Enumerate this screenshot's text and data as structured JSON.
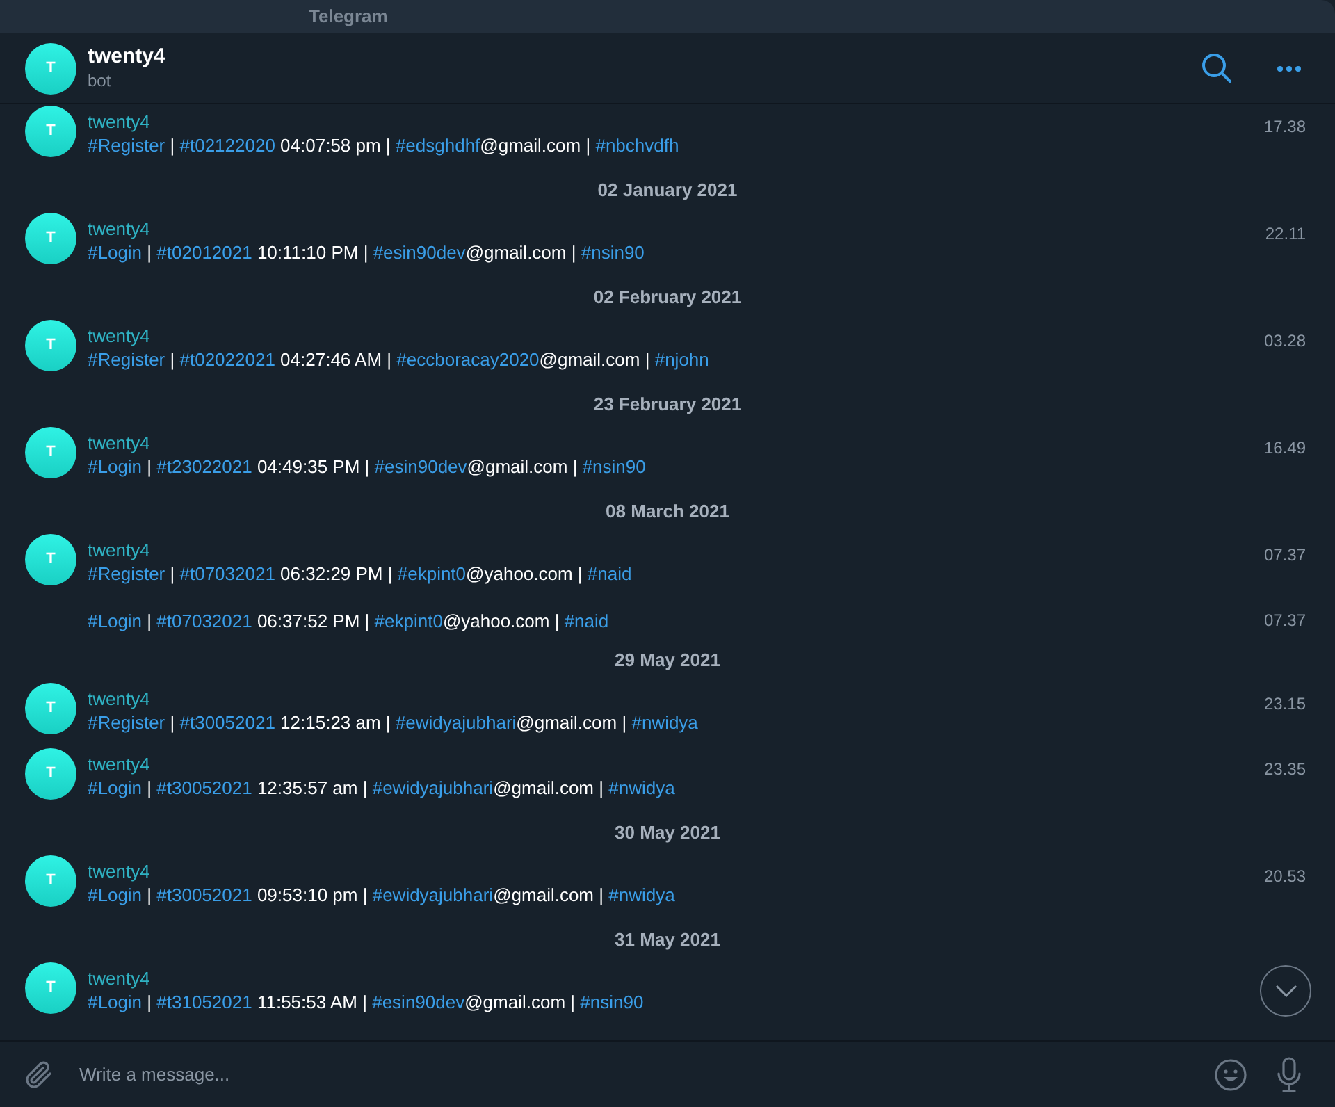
{
  "window": {
    "title": "Telegram"
  },
  "chat": {
    "avatar": "T",
    "name": "twenty4",
    "subtitle": "bot"
  },
  "items": [
    {
      "kind": "message",
      "avatar": "T",
      "sender": "twenty4",
      "time": "17.38",
      "parts": [
        {
          "kind": "tag",
          "text": "#Register"
        },
        {
          "kind": "plain",
          "text": " | "
        },
        {
          "kind": "tag",
          "text": "#t02122020"
        },
        {
          "kind": "plain",
          "text": " 04:07:58 pm | "
        },
        {
          "kind": "tag",
          "text": "#edsghdhf"
        },
        {
          "kind": "plain",
          "text": "@gmail.com | "
        },
        {
          "kind": "tag",
          "text": "#nbchvdfh"
        }
      ]
    },
    {
      "kind": "date",
      "text": "02 January 2021"
    },
    {
      "kind": "message",
      "avatar": "T",
      "sender": "twenty4",
      "time": "22.11",
      "parts": [
        {
          "kind": "tag",
          "text": "#Login"
        },
        {
          "kind": "plain",
          "text": " | "
        },
        {
          "kind": "tag",
          "text": "#t02012021"
        },
        {
          "kind": "plain",
          "text": " 10:11:10 PM | "
        },
        {
          "kind": "tag",
          "text": "#esin90dev"
        },
        {
          "kind": "plain",
          "text": "@gmail.com | "
        },
        {
          "kind": "tag",
          "text": "#nsin90"
        }
      ]
    },
    {
      "kind": "date",
      "text": "02 February 2021"
    },
    {
      "kind": "message",
      "avatar": "T",
      "sender": "twenty4",
      "time": "03.28",
      "parts": [
        {
          "kind": "tag",
          "text": "#Register"
        },
        {
          "kind": "plain",
          "text": " | "
        },
        {
          "kind": "tag",
          "text": "#t02022021"
        },
        {
          "kind": "plain",
          "text": " 04:27:46 AM | "
        },
        {
          "kind": "tag",
          "text": "#eccboracay2020"
        },
        {
          "kind": "plain",
          "text": "@gmail.com | "
        },
        {
          "kind": "tag",
          "text": "#njohn"
        }
      ]
    },
    {
      "kind": "date",
      "text": "23 February 2021"
    },
    {
      "kind": "message",
      "avatar": "T",
      "sender": "twenty4",
      "time": "16.49",
      "parts": [
        {
          "kind": "tag",
          "text": "#Login"
        },
        {
          "kind": "plain",
          "text": " | "
        },
        {
          "kind": "tag",
          "text": "#t23022021"
        },
        {
          "kind": "plain",
          "text": " 04:49:35 PM | "
        },
        {
          "kind": "tag",
          "text": "#esin90dev"
        },
        {
          "kind": "plain",
          "text": "@gmail.com | "
        },
        {
          "kind": "tag",
          "text": "#nsin90"
        }
      ]
    },
    {
      "kind": "date",
      "text": "08 March 2021"
    },
    {
      "kind": "message",
      "avatar": "T",
      "sender": "twenty4",
      "time": "07.37",
      "parts": [
        {
          "kind": "tag",
          "text": "#Register"
        },
        {
          "kind": "plain",
          "text": " | "
        },
        {
          "kind": "tag",
          "text": "#t07032021"
        },
        {
          "kind": "plain",
          "text": " 06:32:29 PM | "
        },
        {
          "kind": "tag",
          "text": "#ekpint0"
        },
        {
          "kind": "plain",
          "text": "@yahoo.com | "
        },
        {
          "kind": "tag",
          "text": "#naid"
        }
      ]
    },
    {
      "kind": "continuation",
      "time": "07.37",
      "parts": [
        {
          "kind": "tag",
          "text": "#Login"
        },
        {
          "kind": "plain",
          "text": " | "
        },
        {
          "kind": "tag",
          "text": "#t07032021"
        },
        {
          "kind": "plain",
          "text": " 06:37:52 PM | "
        },
        {
          "kind": "tag",
          "text": "#ekpint0"
        },
        {
          "kind": "plain",
          "text": "@yahoo.com | "
        },
        {
          "kind": "tag",
          "text": "#naid"
        }
      ]
    },
    {
      "kind": "date",
      "text": "29 May 2021"
    },
    {
      "kind": "message",
      "avatar": "T",
      "sender": "twenty4",
      "time": "23.15",
      "parts": [
        {
          "kind": "tag",
          "text": "#Register"
        },
        {
          "kind": "plain",
          "text": " | "
        },
        {
          "kind": "tag",
          "text": "#t30052021"
        },
        {
          "kind": "plain",
          "text": " 12:15:23 am | "
        },
        {
          "kind": "tag",
          "text": "#ewidyajubhari"
        },
        {
          "kind": "plain",
          "text": "@gmail.com | "
        },
        {
          "kind": "tag",
          "text": "#nwidya"
        }
      ]
    },
    {
      "kind": "message",
      "avatar": "T",
      "sender": "twenty4",
      "time": "23.35",
      "parts": [
        {
          "kind": "tag",
          "text": "#Login"
        },
        {
          "kind": "plain",
          "text": " | "
        },
        {
          "kind": "tag",
          "text": "#t30052021"
        },
        {
          "kind": "plain",
          "text": " 12:35:57 am | "
        },
        {
          "kind": "tag",
          "text": "#ewidyajubhari"
        },
        {
          "kind": "plain",
          "text": "@gmail.com | "
        },
        {
          "kind": "tag",
          "text": "#nwidya"
        }
      ]
    },
    {
      "kind": "date",
      "text": "30 May 2021"
    },
    {
      "kind": "message",
      "avatar": "T",
      "sender": "twenty4",
      "time": "20.53",
      "parts": [
        {
          "kind": "tag",
          "text": "#Login"
        },
        {
          "kind": "plain",
          "text": " | "
        },
        {
          "kind": "tag",
          "text": "#t30052021"
        },
        {
          "kind": "plain",
          "text": " 09:53:10 pm | "
        },
        {
          "kind": "tag",
          "text": "#ewidyajubhari"
        },
        {
          "kind": "plain",
          "text": "@gmail.com | "
        },
        {
          "kind": "tag",
          "text": "#nwidya"
        }
      ]
    },
    {
      "kind": "date",
      "text": "31 May 2021"
    },
    {
      "kind": "message",
      "avatar": "T",
      "sender": "twenty4",
      "parts": [
        {
          "kind": "tag",
          "text": "#Login"
        },
        {
          "kind": "plain",
          "text": " | "
        },
        {
          "kind": "tag",
          "text": "#t31052021"
        },
        {
          "kind": "plain",
          "text": " 11:55:53 AM | "
        },
        {
          "kind": "tag",
          "text": "#esin90dev"
        },
        {
          "kind": "plain",
          "text": "@gmail.com | "
        },
        {
          "kind": "tag",
          "text": "#nsin90"
        }
      ]
    }
  ],
  "composer": {
    "placeholder": "Write a message..."
  }
}
